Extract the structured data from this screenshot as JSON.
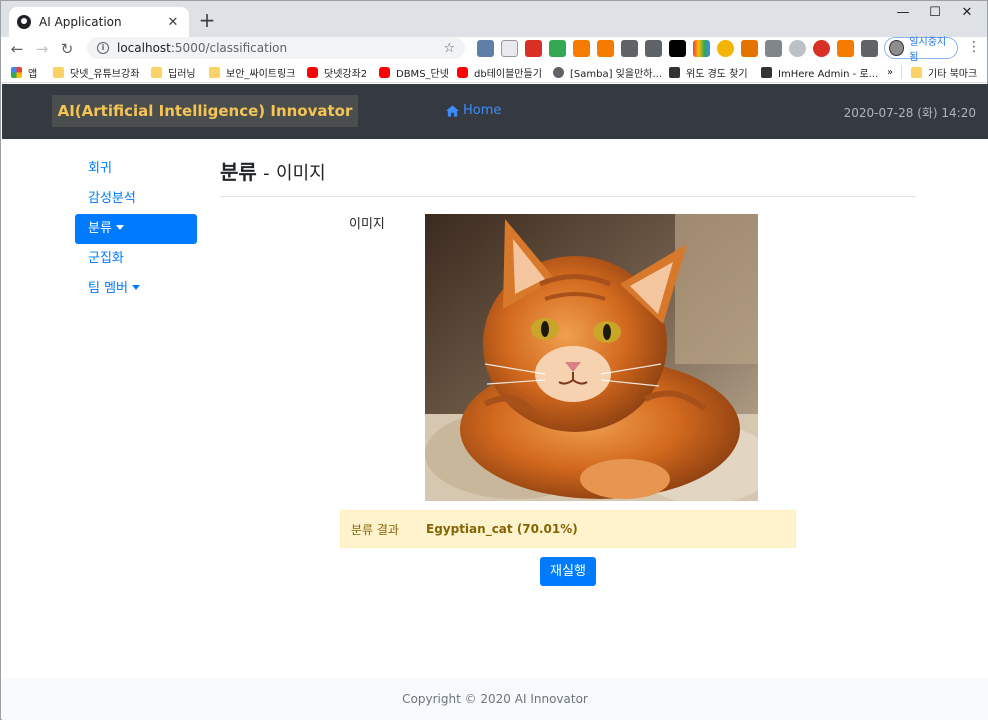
{
  "browser": {
    "tab_title": "AI Application",
    "url_host": "localhost",
    "url_rest": ":5000/classification",
    "profile_label": "일시중지됨",
    "bookmarks": [
      "앱",
      "닷넷_유튜브강좌",
      "딥러닝",
      "보안_싸이트링크",
      "닷넷강좌2",
      "DBMS_단넷",
      "db테이블만들기",
      "[Samba] 잊을만하...",
      "위도 경도 찾기",
      "ImHere Admin - 로...",
      "기타 북마크"
    ],
    "bookmarks_overflow": "»"
  },
  "navbar": {
    "brand": "AI(Artificial Intelligence) Innovator",
    "home": "Home",
    "datetime": "2020-07-28 (화) 14:20"
  },
  "sidebar": {
    "items": [
      {
        "label": "회귀"
      },
      {
        "label": "감성분석"
      },
      {
        "label": "분류"
      },
      {
        "label": "군집화"
      },
      {
        "label": "팀 멤버"
      }
    ]
  },
  "main": {
    "title": "분류",
    "separator": "-",
    "subtitle": "이미지",
    "image_label": "이미지",
    "result_label": "분류 결과",
    "result_value": "Egyptian_cat (70.01%)",
    "rerun_button": "재실행"
  },
  "footer": {
    "copyright": "Copyright © 2020 AI Innovator"
  },
  "colors": {
    "navbar_bg": "#343a40",
    "brand_text": "#f5c453",
    "primary": "#007bff",
    "alert_bg": "#fff3cd",
    "alert_text": "#856404"
  },
  "icons": [
    "home-icon",
    "caret-down-icon",
    "star-icon",
    "info-icon",
    "back-icon",
    "forward-icon",
    "reload-icon",
    "close-icon",
    "new-tab-icon"
  ]
}
